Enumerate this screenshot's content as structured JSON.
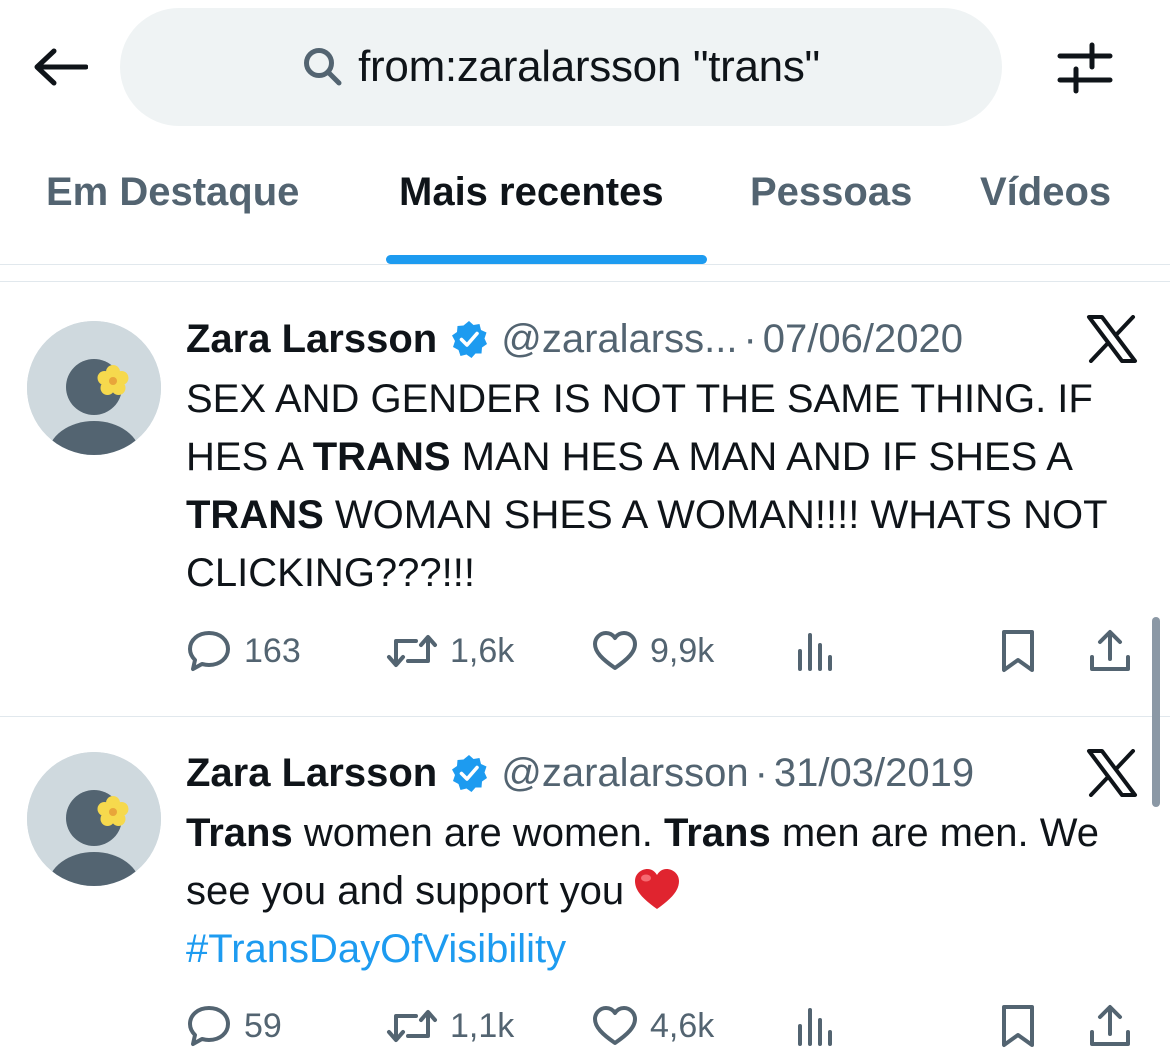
{
  "search": {
    "query": "from:zaralarsson \"trans\""
  },
  "tabs": [
    {
      "label": "Em Destaque",
      "active": false
    },
    {
      "label": "Mais recentes",
      "active": true
    },
    {
      "label": "Pessoas",
      "active": false
    },
    {
      "label": "Vídeos",
      "active": false
    }
  ],
  "tweets": [
    {
      "display_name": "Zara Larsson",
      "handle": "@zaralarss...",
      "separator": "·",
      "date": "07/06/2020",
      "text_parts": [
        "SEX AND GENDER IS NOT THE SAME THING. IF HES A ",
        "TRANS",
        " MAN HES A MAN AND IF SHES A ",
        "TRANS",
        " WOMAN SHES A WOMAN!!!! WHATS NOT CLICKING???!!!"
      ],
      "replies": "163",
      "reposts": "1,6k",
      "likes": "9,9k"
    },
    {
      "display_name": "Zara Larsson",
      "handle": "@zaralarsson",
      "separator": "·",
      "date": "31/03/2019",
      "text_parts": [
        "Trans",
        " women are women. ",
        "Trans",
        " men are men. We see you and support you"
      ],
      "hashtag": "#TransDayOfVisibility",
      "replies": "59",
      "reposts": "1,1k",
      "likes": "4,6k"
    }
  ],
  "colors": {
    "accent": "#1d9bf0",
    "muted_text": "#536471",
    "search_bg": "#eff3f4"
  },
  "icons": [
    "back-arrow-icon",
    "search-icon",
    "filter-sliders-icon",
    "verified-badge-icon",
    "x-logo-icon",
    "reply-icon",
    "repost-icon",
    "like-icon",
    "views-icon",
    "bookmark-icon",
    "share-icon",
    "heart-emoji-icon"
  ]
}
